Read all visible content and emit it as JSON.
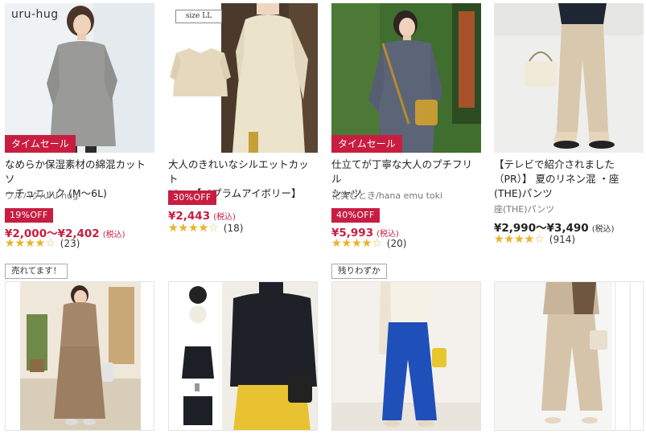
{
  "products": [
    {
      "image_label": "uru-hug",
      "sale_ribbon": "タイムセール",
      "title_lines": [
        "なめらか保湿素材の綿混カットソ",
        "ーチュニック (M～6L)"
      ],
      "brand": "ウルハグ/uru-hug",
      "discount": "19%OFF",
      "price": "¥2,000～¥2,402",
      "tax": "(税込)",
      "rating": 4.0,
      "reviews": "(23)"
    },
    {
      "image_label": "size LL",
      "title_lines": [
        "大人のきれいなシルエットカット",
        "ソー 【ペプラムアイボリー】"
      ],
      "discount": "30%OFF",
      "price": "¥2,443",
      "tax": "(税込)",
      "rating": 4.0,
      "reviews": "(18)"
    },
    {
      "sale_ribbon": "タイムセール",
      "title_lines": [
        "仕立てが丁寧な大人のプチフリル",
        "シャツ"
      ],
      "brand": "花笑むとき/hana emu toki",
      "discount": "40%OFF",
      "price": "¥5,993",
      "tax": "(税込)",
      "rating": 4.0,
      "reviews": "(20)"
    },
    {
      "title_lines": [
        "【テレビで紹介されました",
        "（PR）】 夏のリネン混 ・座",
        "(THE)パンツ"
      ],
      "brand": "座(THE)パンツ",
      "price": "¥2,990～¥3,490",
      "tax": "(税込)",
      "rating": 4.0,
      "reviews": "(914)"
    }
  ],
  "second_row": [
    {
      "badge": "売れてます！"
    },
    {
      "badge": ""
    },
    {
      "badge": "残りわずか"
    },
    {
      "badge": ""
    }
  ],
  "stars": {
    "full": "★★★★★",
    "empty": "☆☆☆☆☆"
  },
  "colors": {
    "sale": "#c81d41",
    "star": "#e8b42c"
  }
}
